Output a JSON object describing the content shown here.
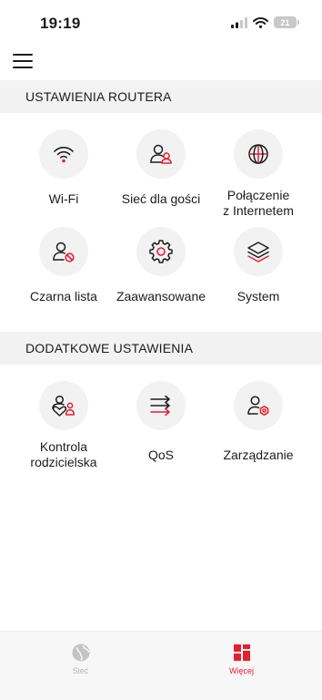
{
  "status_bar": {
    "time": "19:19",
    "battery": "21"
  },
  "accent_color": "#e5202e",
  "sections": {
    "router": {
      "title": "USTAWIENIA ROUTERA"
    },
    "additional": {
      "title": "DODATKOWE USTAWIENIA"
    }
  },
  "tiles": {
    "wifi": {
      "label": "Wi-Fi",
      "icon": "wifi-icon"
    },
    "guest": {
      "label": "Sieć dla gości",
      "icon": "guest-network-icon"
    },
    "internet": {
      "label_line1": "Połączenie",
      "label_line2": "z Internetem",
      "icon": "globe-icon"
    },
    "blacklist": {
      "label": "Czarna lista",
      "icon": "blocked-user-icon"
    },
    "advanced": {
      "label": "Zaawansowane",
      "icon": "gear-icon"
    },
    "system": {
      "label": "System",
      "icon": "layers-icon"
    },
    "parental": {
      "label_line1": "Kontrola",
      "label_line2": "rodzicielska",
      "icon": "parental-control-icon"
    },
    "qos": {
      "label": "QoS",
      "icon": "arrows-icon"
    },
    "management": {
      "label": "Zarządzanie",
      "icon": "user-settings-icon"
    }
  },
  "tab_bar": {
    "network": {
      "label": "Sieć",
      "icon": "globe-icon"
    },
    "more": {
      "label": "Więcej",
      "icon": "grid-icon"
    }
  }
}
